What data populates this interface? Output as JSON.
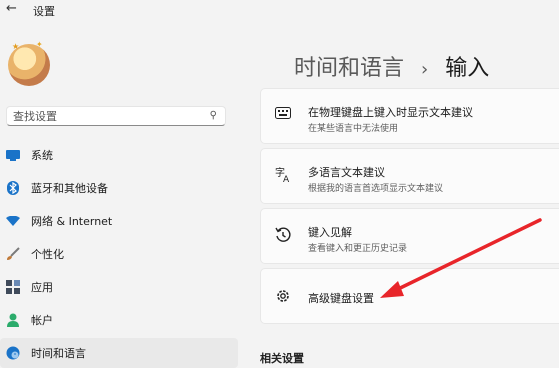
{
  "window": {
    "back_glyph": "←",
    "title": "设置"
  },
  "search": {
    "placeholder": "查找设置"
  },
  "sidebar": {
    "items": [
      {
        "label": "系统",
        "icon": "monitor-icon",
        "color": "#1a73c8"
      },
      {
        "label": "蓝牙和其他设备",
        "icon": "bluetooth-icon",
        "color": "#1a73c8"
      },
      {
        "label": "网络 & Internet",
        "icon": "wifi-icon",
        "color": "#1a73c8"
      },
      {
        "label": "个性化",
        "icon": "brush-icon",
        "color": "#c07a3a"
      },
      {
        "label": "应用",
        "icon": "apps-icon",
        "color": "#3f4a5a"
      },
      {
        "label": "帐户",
        "icon": "person-icon",
        "color": "#2bab6b"
      },
      {
        "label": "时间和语言",
        "icon": "globe-clock-icon",
        "color": "#1a73c8",
        "active": true
      }
    ]
  },
  "main": {
    "breadcrumb_parent": "时间和语言",
    "breadcrumb_sep": "›",
    "breadcrumb_current": "输入",
    "cards": [
      {
        "title": "在物理键盘上键入时显示文本建议",
        "subtitle": "在某些语言中无法使用",
        "icon": "keyboard-icon"
      },
      {
        "title": "多语言文本建议",
        "subtitle": "根据我的语言首选项显示文本建议",
        "icon": "language-icon"
      },
      {
        "title": "键入见解",
        "subtitle": "查看键入和更正历史记录",
        "icon": "history-icon"
      },
      {
        "title": "高级键盘设置",
        "subtitle": "",
        "icon": "gear-icon"
      }
    ],
    "section_heading": "相关设置"
  },
  "annotation": {
    "arrow_color": "#e8252a"
  }
}
